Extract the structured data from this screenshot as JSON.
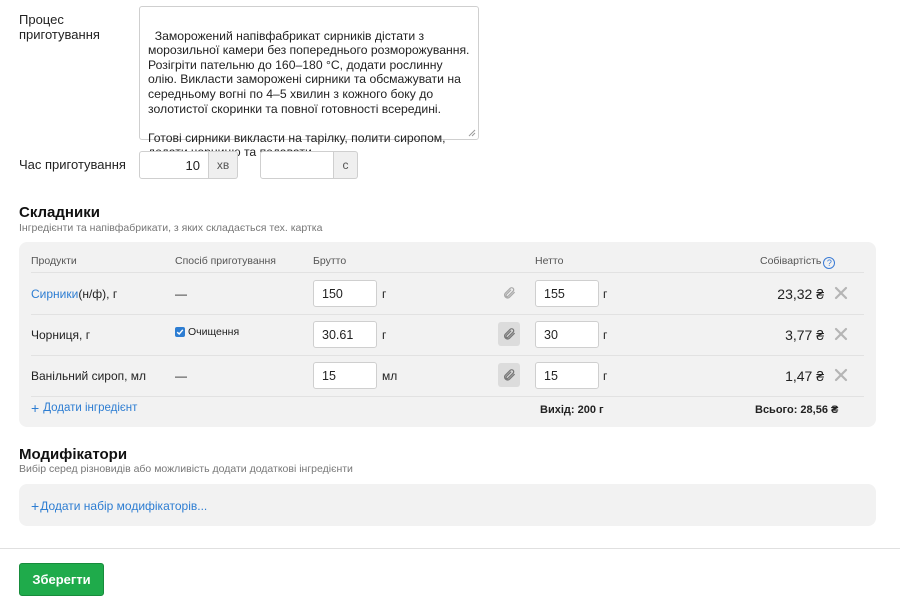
{
  "process": {
    "label": "Процес\nприготування",
    "text": "Заморожений напівфабрикат сирників дістати з морозильної камери без попереднього розморожування. Розігріти пательню до 160–180 °С, додати рослинну олію. Викласти заморожені сирники та обсмажувати на середньому вогні по 4–5 хвилин з кожного боку до золотистої скоринки та повної готовності всередині.\n\nГотові сирники викласти на тарілку, полити сиропом, додати чорницю та подавати."
  },
  "cook_time": {
    "label": "Час приготування",
    "minutes_value": "10",
    "minutes_unit": "хв",
    "seconds_value": "",
    "seconds_unit": "с"
  },
  "ingredients": {
    "title": "Складники",
    "subtitle": "Інгредієнти та напівфабрикати, з яких складається тех. картка",
    "headers": {
      "product": "Продукти",
      "method": "Спосіб приготування",
      "gross": "Брутто",
      "net": "Нетто",
      "cost": "Собівартість",
      "help": "?"
    },
    "rows": [
      {
        "product_link": "Сирники",
        "product_rest": " (н/ф), г",
        "method": "—",
        "method_checked": false,
        "gross": "150",
        "gross_unit": "г",
        "net": "155",
        "net_unit": "г",
        "cost": "23,32 ₴"
      },
      {
        "product_link": "",
        "product_rest": "Чорниця, г",
        "method": "Очищення",
        "method_checked": true,
        "gross": "30.61",
        "gross_unit": "г",
        "net": "30",
        "net_unit": "г",
        "cost": "3,77 ₴"
      },
      {
        "product_link": "",
        "product_rest": "Ванільний сироп, мл",
        "method": "—",
        "method_checked": false,
        "gross": "15",
        "gross_unit": "мл",
        "net": "15",
        "net_unit": "г",
        "cost": "1,47 ₴"
      }
    ],
    "add_label": "Додати інгредієнт",
    "output": "Вихід: 200 г",
    "total": "Всього: 28,56 ₴"
  },
  "modifiers": {
    "title": "Модифікатори",
    "subtitle": "Вибір серед різновидів або можливість додати додаткові інгредієнти",
    "add_label": "Додати набір модифікаторів..."
  },
  "save_label": "Зберегти",
  "colors": {
    "accent_link": "#2d7dd2",
    "save_green": "#1fab4b"
  }
}
